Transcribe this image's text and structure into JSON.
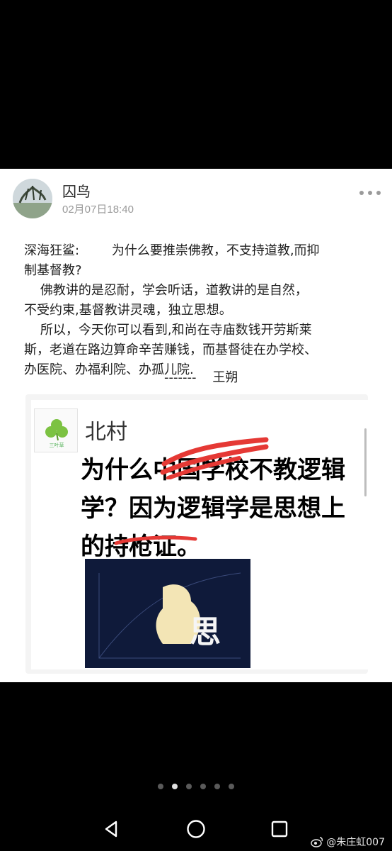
{
  "post": {
    "username": "囚鸟",
    "timestamp": "02月07日18:40",
    "text_lines": [
      "深海狂鲨:        为什么要推崇佛教，不支持道教,而抑",
      "制基督教?",
      "    佛教讲的是忍耐，学会听话，道教讲的是自然，",
      "不受约束,基督教讲灵魂，独立思想。",
      "    所以，今天你可以看到,和尚在寺庙数钱开劳斯莱",
      "斯，老道在路边算命辛苦赚钱，而基督徒在办学校、",
      "办医院、办福利院、办孤儿院."
    ],
    "signature": "-------    王朔"
  },
  "embed": {
    "source_name": "北村",
    "logo_text": "三叶草",
    "headline_lines": [
      "为什么中国学校不教逻辑",
      "学？因为逻辑学是思想上",
      "的持枪证。"
    ],
    "thumbnail_label": "思"
  },
  "pager": {
    "count": 6,
    "active_index": 1
  },
  "nav": {
    "back_icon": "back-triangle-icon",
    "home_icon": "home-circle-icon",
    "recent_icon": "recent-square-icon"
  },
  "watermark": {
    "text": "@朱庄虹007"
  },
  "colors": {
    "accent_red": "#e53935",
    "card_bg": "#ffffff",
    "screen_bg": "#000000"
  }
}
